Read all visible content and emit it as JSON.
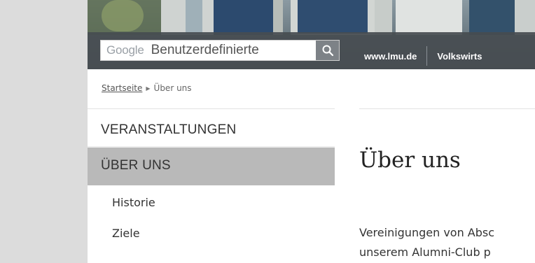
{
  "header": {
    "search": {
      "brand": "Google",
      "value": "Benutzerdefinierte",
      "button_icon": "search-icon"
    },
    "links": [
      "www.lmu.de",
      "Volkswirts"
    ]
  },
  "breadcrumb": {
    "home": "Startseite",
    "current": "Über uns"
  },
  "sidebar": {
    "items": [
      {
        "label": "VERANSTALTUNGEN"
      },
      {
        "label": "ÜBER UNS",
        "active": true
      }
    ],
    "subitems": [
      {
        "label": "Historie"
      },
      {
        "label": "Ziele"
      }
    ]
  },
  "main": {
    "title": "Über uns",
    "intro_lines": [
      "Vereinigungen von Absc",
      "unserem Alumni-Club p"
    ]
  },
  "colors": {
    "gutter": "#dcdcdc",
    "active_nav": "#b9b9b9",
    "search_strip": "#464c50"
  }
}
